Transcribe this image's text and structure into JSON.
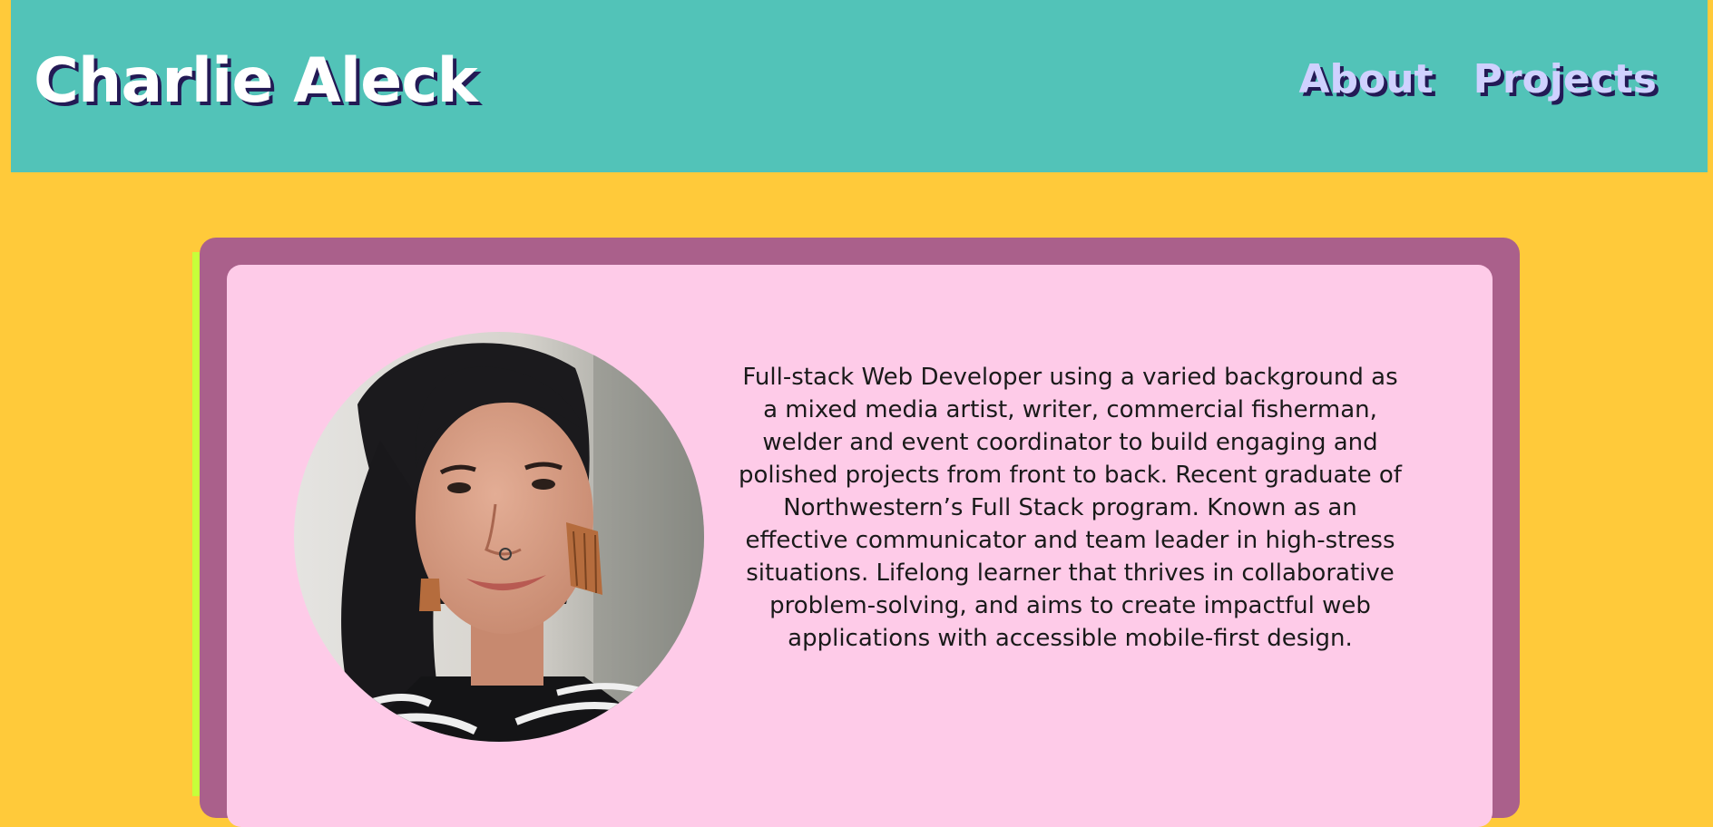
{
  "header": {
    "title": "Charlie Aleck",
    "nav": [
      {
        "label": "About"
      },
      {
        "label": "Projects"
      }
    ]
  },
  "profile": {
    "bio": "Full-stack Web Developer using a varied background as a mixed media artist, writer, commercial fisherman, welder and event coordinator to build engaging and polished projects from front to back. Recent graduate of Northwestern’s Full Stack program. Known as an effective communicator and team leader in high-stress situations. Lifelong learner that thrives in collaborative problem-solving, and aims to create impactful web applications with accessible mobile-first design."
  },
  "colors": {
    "page_background": "#ffca3a",
    "header_background": "#52c3b8",
    "card_border": "#aa608b",
    "card_background": "#fecbe8",
    "card_edge": "#c6ff3a",
    "title_shadow": "#231a55",
    "nav_text": "#cfd1ff"
  }
}
